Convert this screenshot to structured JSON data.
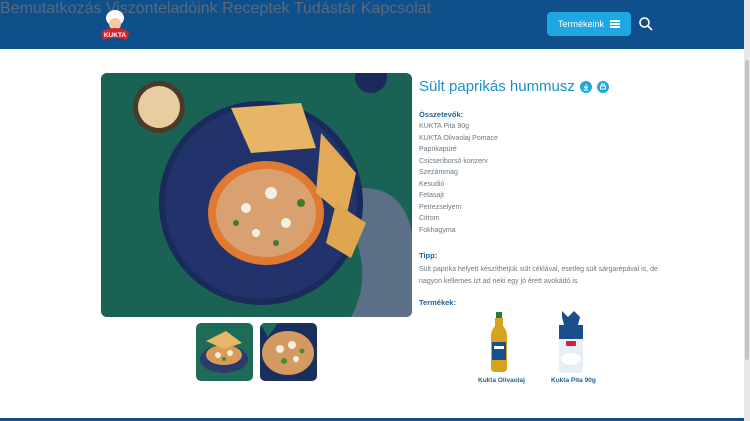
{
  "header": {
    "logo_text": "KUKTA",
    "nav": [
      "Bemutatkozás",
      "Viszonteladóink",
      "Receptek",
      "Tudástár",
      "Kapcsolat"
    ],
    "products_button": "Termékeink"
  },
  "recipe": {
    "title": "Sült paprikás hummusz",
    "ingredients_label": "Összetevők:",
    "ingredients": [
      "KUKTA Pita 90g",
      "KUKTA Olivaolaj Pomace",
      "Paprikapüré",
      "Csicseriborsó konzerv",
      "Szezámmag",
      "Kesudió",
      "Fetasajt",
      "Petrezselyem",
      "Citrom",
      "Fokhagyma"
    ],
    "tip_label": "Tipp:",
    "tip": "Sült paprika helyett készíthetjük sült céklával, esetleg sült sárgarépával is, de nagyon kellemes ízt ad neki egy jó érett avokádó is.",
    "products_label": "Termékek:",
    "products": [
      {
        "name": "Kukta Olivaolaj",
        "icon": "olive-oil-bottle"
      },
      {
        "name": "Kukta Pita 90g",
        "icon": "pita-bag"
      }
    ]
  },
  "colors": {
    "header": "#0f4f8c",
    "accent": "#1fa7e1",
    "title": "#1a8fcf",
    "label": "#1f5f99"
  }
}
